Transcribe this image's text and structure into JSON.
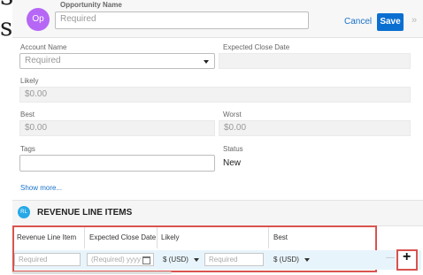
{
  "header": {
    "avatar_text": "Op",
    "field_label": "Opportunity Name",
    "name_placeholder": "Required",
    "cancel_label": "Cancel",
    "save_label": "Save",
    "overflow": "»"
  },
  "form": {
    "account_name_label": "Account Name",
    "account_name_value": "Required",
    "expected_close_label": "Expected Close Date",
    "likely_label": "Likely",
    "likely_value": "$0.00",
    "best_label": "Best",
    "best_value": "$0.00",
    "worst_label": "Worst",
    "worst_value": "$0.00",
    "tags_label": "Tags",
    "status_label": "Status",
    "status_value": "New",
    "show_more": "Show more..."
  },
  "rli": {
    "badge": "RL",
    "title": "REVENUE LINE ITEMS",
    "columns": [
      "Revenue Line Item",
      "Expected Close Date",
      "Likely",
      "Best"
    ],
    "row": {
      "item_placeholder": "Required",
      "date_placeholder": "(Required) yyyy",
      "likely_currency": "$ (USD)",
      "likely_placeholder": "Required",
      "best_currency": "$ (USD)"
    },
    "remove_label": "—",
    "add_label": "+"
  }
}
